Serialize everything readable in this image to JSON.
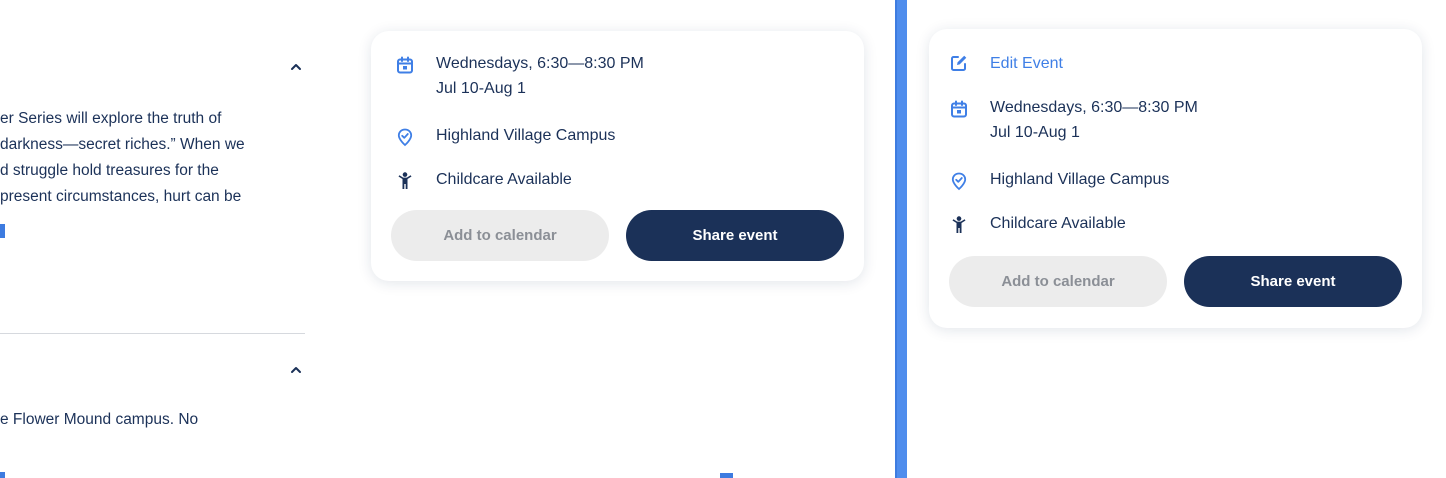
{
  "left_panel": {
    "section1": {
      "lines": [
        "er Series will explore the truth of",
        " darkness—secret riches.” When we",
        "d struggle hold treasures for the",
        " present circumstances, hurt can be"
      ]
    },
    "section2": {
      "lines": [
        "e Flower Mound campus. No"
      ]
    }
  },
  "event_card": {
    "schedule_line1": "Wednesdays, 6:30—8:30 PM",
    "schedule_line2": "Jul 10-Aug 1",
    "location": "Highland Village Campus",
    "childcare": "Childcare Available",
    "add_to_calendar": "Add to calendar",
    "share_event": "Share event"
  },
  "event_card_right": {
    "edit_event": "Edit Event",
    "schedule_line1": "Wednesdays, 6:30—8:30 PM",
    "schedule_line2": "Jul 10-Aug 1",
    "location": "Highland Village Campus",
    "childcare": "Childcare Available",
    "add_to_calendar": "Add to calendar",
    "share_event": "Share event"
  },
  "colors": {
    "accent": "#3f7fe6",
    "navy": "#1b3158",
    "divider": "#4f8ded"
  }
}
